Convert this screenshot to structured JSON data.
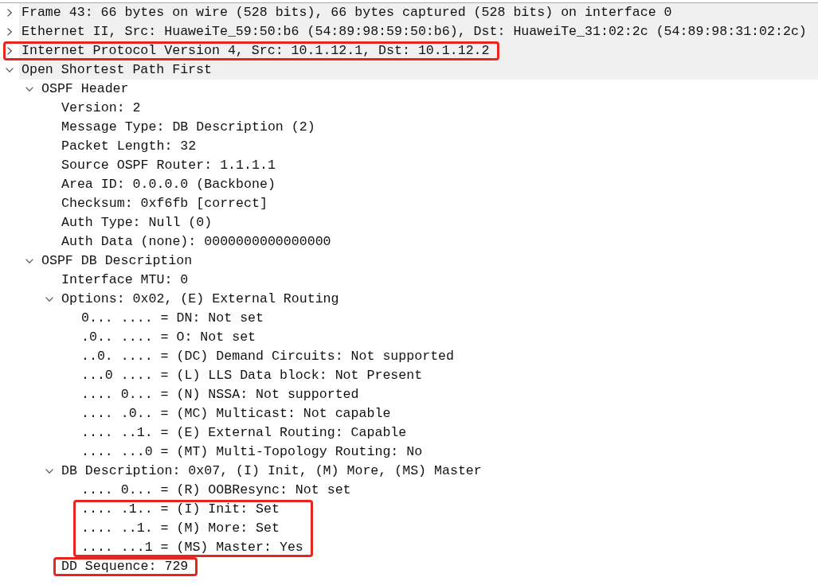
{
  "tree": [
    {
      "label": "Frame 43: 66 bytes on wire (528 bits), 66 bytes captured (528 bits) on interface 0",
      "expanded": false,
      "marked": false
    },
    {
      "label": "Ethernet II, Src: HuaweiTe_59:50:b6 (54:89:98:59:50:b6), Dst: HuaweiTe_31:02:2c (54:89:98:31:02:2c)",
      "expanded": false,
      "marked": false
    },
    {
      "label": "Internet Protocol Version 4, Src: 10.1.12.1, Dst: 10.1.12.2",
      "expanded": false,
      "marked": true
    },
    {
      "label": "Open Shortest Path First",
      "expanded": true,
      "marked": false,
      "children": [
        {
          "label": "OSPF Header",
          "expanded": true,
          "marked": false,
          "children": [
            {
              "label": "Version: 2",
              "marked": false
            },
            {
              "label": "Message Type: DB Description (2)",
              "marked": false
            },
            {
              "label": "Packet Length: 32",
              "marked": false
            },
            {
              "label": "Source OSPF Router: 1.1.1.1",
              "marked": false
            },
            {
              "label": "Area ID: 0.0.0.0 (Backbone)",
              "marked": false
            },
            {
              "label": "Checksum: 0xf6fb [correct]",
              "marked": false
            },
            {
              "label": "Auth Type: Null (0)",
              "marked": false
            },
            {
              "label": "Auth Data (none): 0000000000000000",
              "marked": false
            }
          ]
        },
        {
          "label": "OSPF DB Description",
          "expanded": true,
          "marked": false,
          "children": [
            {
              "label": "Interface MTU: 0",
              "marked": false
            },
            {
              "label": "Options: 0x02, (E) External Routing",
              "expanded": true,
              "marked": false,
              "children": [
                {
                  "label": "0... .... = DN: Not set",
                  "marked": false
                },
                {
                  "label": ".0.. .... = O: Not set",
                  "marked": false
                },
                {
                  "label": "..0. .... = (DC) Demand Circuits: Not supported",
                  "marked": false
                },
                {
                  "label": "...0 .... = (L) LLS Data block: Not Present",
                  "marked": false
                },
                {
                  "label": ".... 0... = (N) NSSA: Not supported",
                  "marked": false
                },
                {
                  "label": ".... .0.. = (MC) Multicast: Not capable",
                  "marked": false
                },
                {
                  "label": ".... ..1. = (E) External Routing: Capable",
                  "marked": false
                },
                {
                  "label": ".... ...0 = (MT) Multi-Topology Routing: No",
                  "marked": false
                }
              ]
            },
            {
              "label": "DB Description: 0x07, (I) Init, (M) More, (MS) Master",
              "expanded": true,
              "marked": false,
              "children": [
                {
                  "label": ".... 0... = (R) OOBResync: Not set",
                  "marked": false
                },
                {
                  "label": ".... .1.. = (I) Init: Set",
                  "marked": true
                },
                {
                  "label": ".... ..1. = (M) More: Set",
                  "marked": true
                },
                {
                  "label": ".... ...1 = (MS) Master: Yes",
                  "marked": true
                }
              ]
            },
            {
              "label": "DD Sequence: 729",
              "marked": true
            }
          ]
        }
      ]
    }
  ]
}
